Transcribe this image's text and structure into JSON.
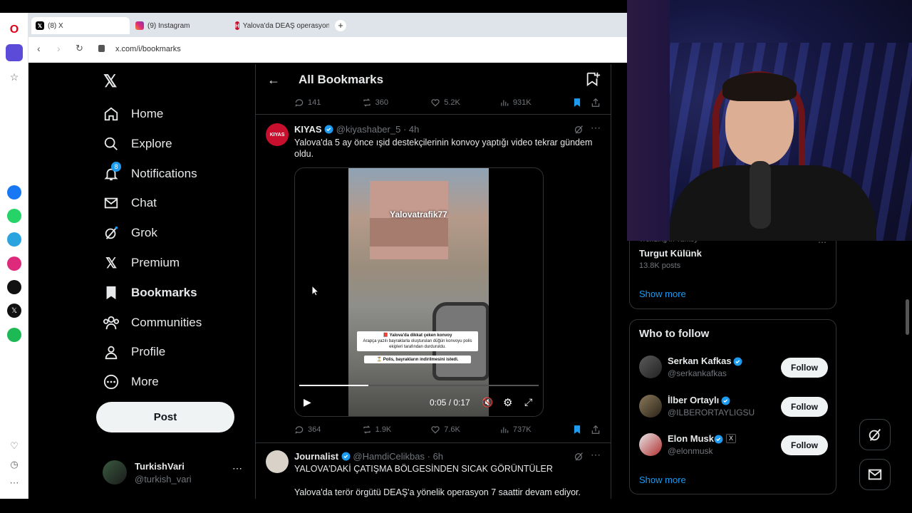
{
  "browser": {
    "tabs": [
      {
        "label": "(8) X"
      },
      {
        "label": "(9) Instagram"
      },
      {
        "label": "Yalova'da DEAŞ operasyon"
      }
    ],
    "address": "x.com/i/bookmarks"
  },
  "nav": {
    "items": [
      {
        "label": "Home"
      },
      {
        "label": "Explore"
      },
      {
        "label": "Notifications",
        "badge": "8"
      },
      {
        "label": "Chat"
      },
      {
        "label": "Grok"
      },
      {
        "label": "Premium"
      },
      {
        "label": "Bookmarks"
      },
      {
        "label": "Communities"
      },
      {
        "label": "Profile"
      },
      {
        "label": "More"
      }
    ],
    "post_label": "Post",
    "account": {
      "name": "TurkishVari",
      "handle": "@turkish_vari"
    }
  },
  "header": {
    "title": "All Bookmarks"
  },
  "prev_tweet": {
    "replies": "141",
    "reposts": "360",
    "likes": "5.2K",
    "views": "931K"
  },
  "tweet1": {
    "avatar_text": "KIYAS",
    "name": "KIYAS",
    "handle": "@kiyashaber_5",
    "time": "· 4h",
    "text": "Yalova'da 5 ay önce ışid destekçilerinin konvoy yaptığı video tekrar gündem oldu.",
    "video": {
      "watermark": "Yalovatrafik77",
      "caption_1": "📕 Yalova'da dikkat çeken konvoy",
      "caption_2": "Arapça yazılı bayraklarla oluşturulan düğün konvoyu polis ekipleri tarafından durduruldu.",
      "caption_3": "⏳ Polis, bayrakların indirilmesini istedi.",
      "time": "0:05 / 0:17",
      "progress": 0.29
    },
    "replies": "364",
    "reposts": "1.9K",
    "likes": "7.6K",
    "views": "737K"
  },
  "tweet2": {
    "name": "Journalist",
    "handle": "@HamdiCelikbas",
    "time": "· 6h",
    "text": "YALOVA'DAKİ ÇATIŞMA BÖLGESİNDEN SICAK GÖRÜNTÜLER",
    "text2": "Yalova'da terör örgütü DEAŞ'a yönelik operasyon 7 saattir devam ediyor."
  },
  "trends": {
    "context": "Trending in Turkey",
    "name": "Turgut Külünk",
    "posts": "13.8K posts",
    "show_more": "Show more"
  },
  "who_to_follow": {
    "title": "Who to follow",
    "users": [
      {
        "name": "Serkan Kafkas",
        "handle": "@serkankafkas",
        "button": "Follow"
      },
      {
        "name": "İlber Ortaylı",
        "handle": "@ILBERORTAYLIGSU",
        "button": "Follow"
      },
      {
        "name": "Elon Musk",
        "handle": "@elonmusk",
        "button": "Follow",
        "badge": "X"
      }
    ],
    "show_more": "Show more"
  },
  "colors": {
    "accent": "#1d9bf0",
    "bg": "#000000",
    "muted": "#71767b"
  }
}
